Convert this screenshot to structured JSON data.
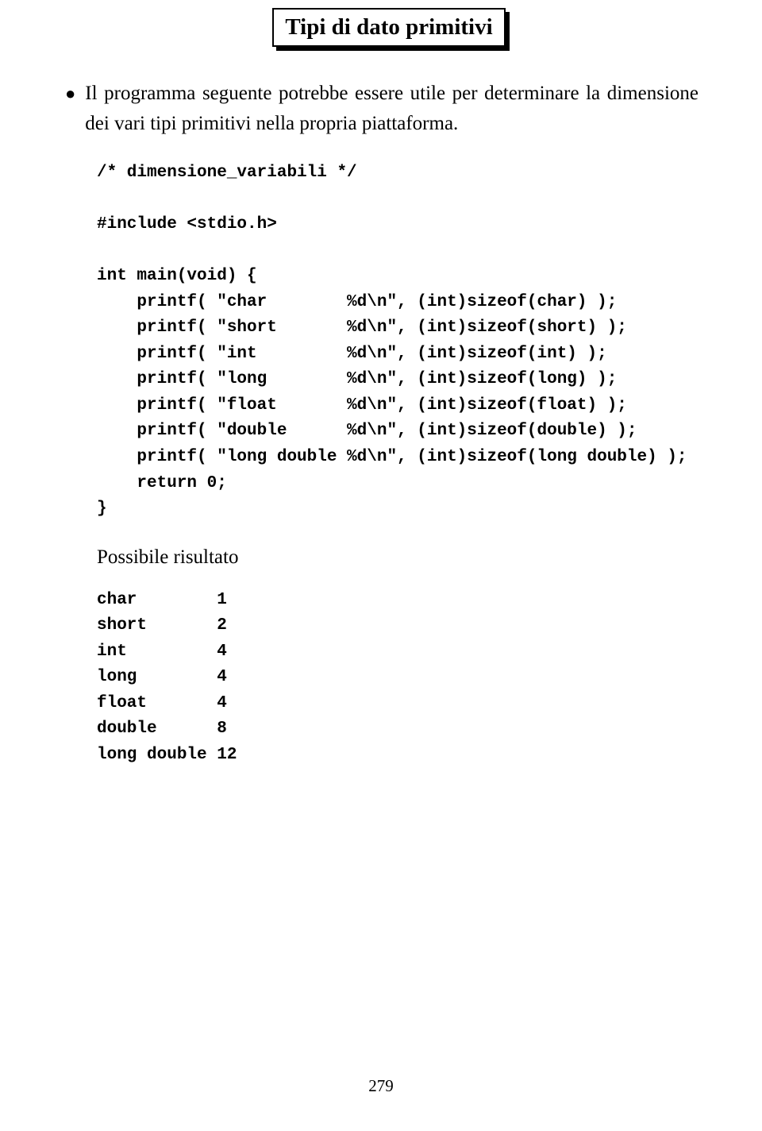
{
  "title": "Tipi di dato primitivi",
  "bullet_text": "Il programma seguente potrebbe essere utile per determinare la dimensione dei vari tipi primitivi nella propria piattaforma.",
  "code": "/* dimensione_variabili */\n\n#include <stdio.h>\n\nint main(void) {\n    printf( \"char        %d\\n\", (int)sizeof(char) );\n    printf( \"short       %d\\n\", (int)sizeof(short) );\n    printf( \"int         %d\\n\", (int)sizeof(int) );\n    printf( \"long        %d\\n\", (int)sizeof(long) );\n    printf( \"float       %d\\n\", (int)sizeof(float) );\n    printf( \"double      %d\\n\", (int)sizeof(double) );\n    printf( \"long double %d\\n\", (int)sizeof(long double) );\n    return 0;\n}",
  "result_label": "Possibile risultato",
  "result": "char        1\nshort       2\nint         4\nlong        4\nfloat       4\ndouble      8\nlong double 12",
  "page_number": "279"
}
